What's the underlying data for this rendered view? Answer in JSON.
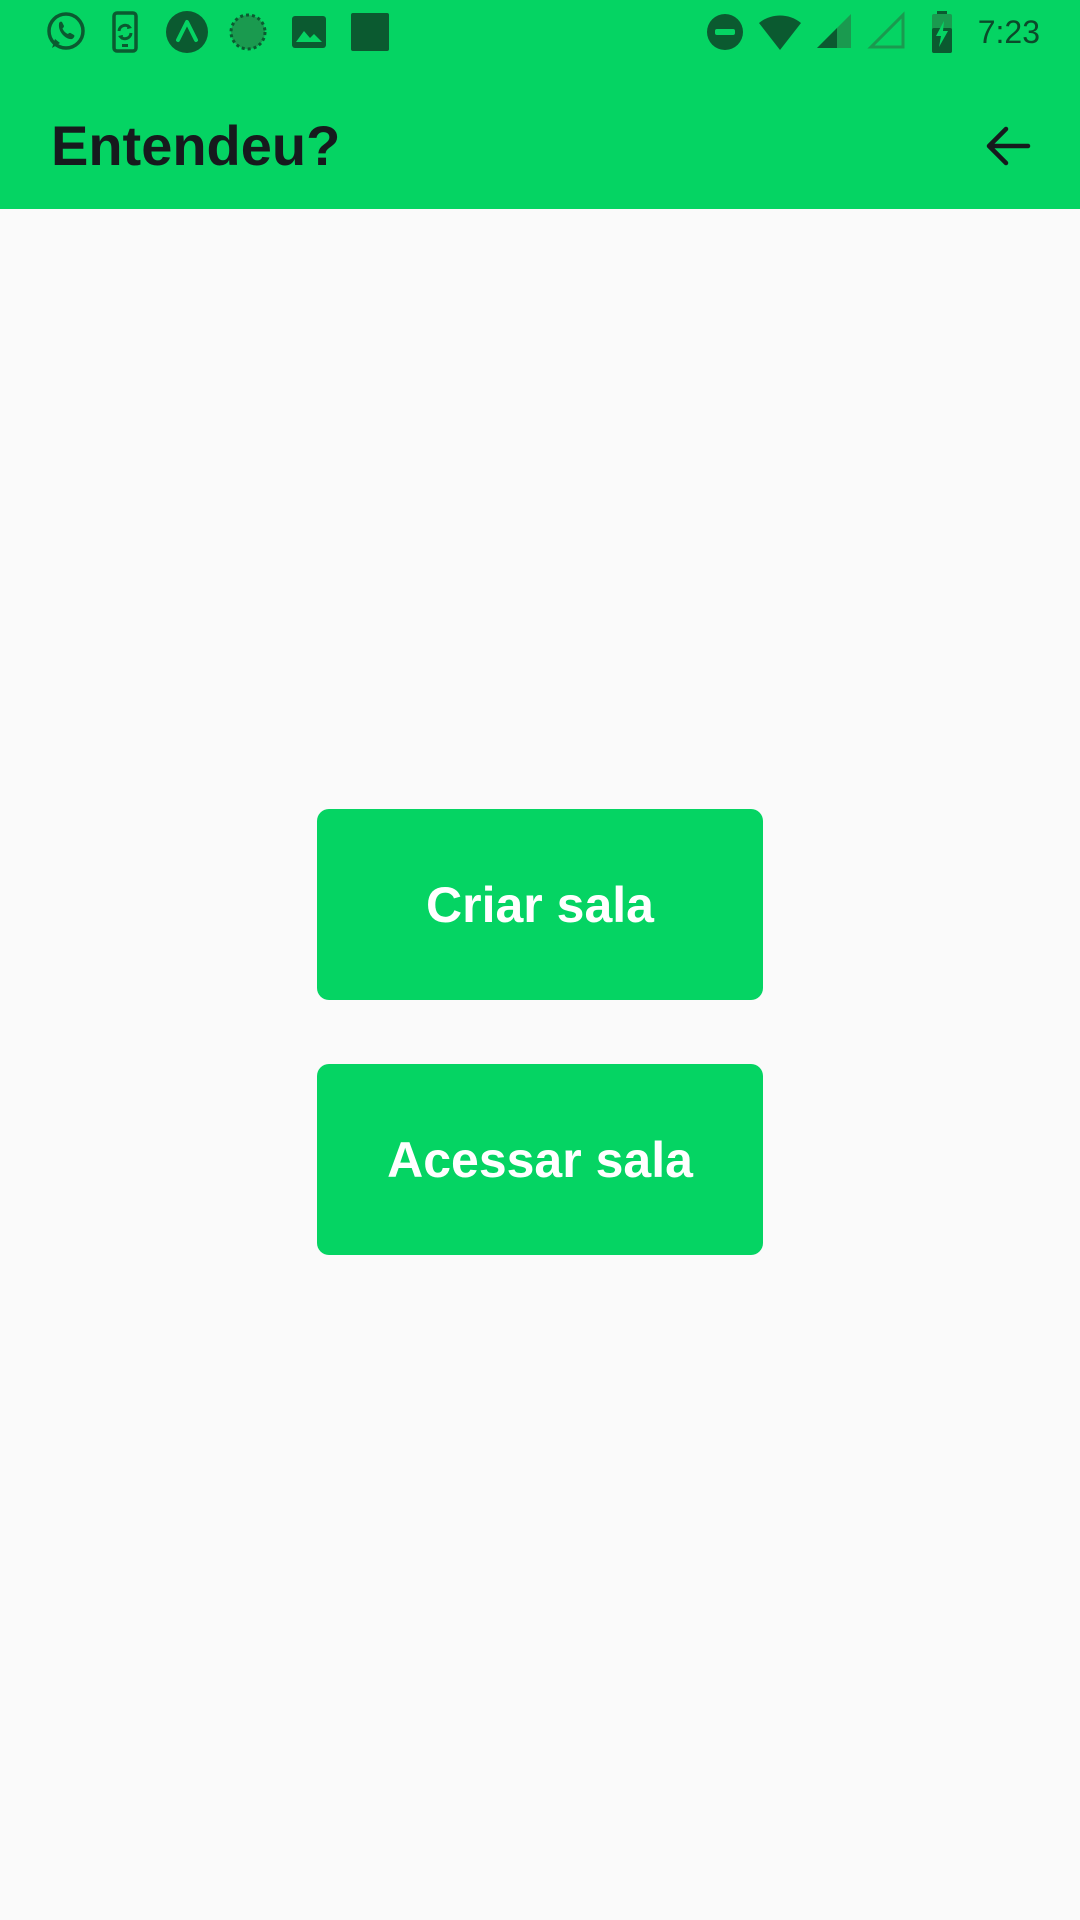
{
  "status_bar": {
    "time": "7:23",
    "left_icons": [
      "whatsapp-icon",
      "phone-sync-icon",
      "expo-icon",
      "loading-circle-icon",
      "image-icon",
      "stop-square-icon"
    ],
    "right_icons": [
      "do-not-disturb-icon",
      "wifi-icon",
      "cell-signal-icon",
      "cell-signal-empty-icon",
      "battery-charging-icon"
    ],
    "color": "#05d463"
  },
  "app_bar": {
    "title": "Entendeu?",
    "back_icon": "arrow-back-icon",
    "color": "#05d463"
  },
  "main": {
    "buttons": [
      {
        "label": "Criar sala"
      },
      {
        "label": "Acessar sala"
      }
    ],
    "button_color": "#05d463"
  }
}
